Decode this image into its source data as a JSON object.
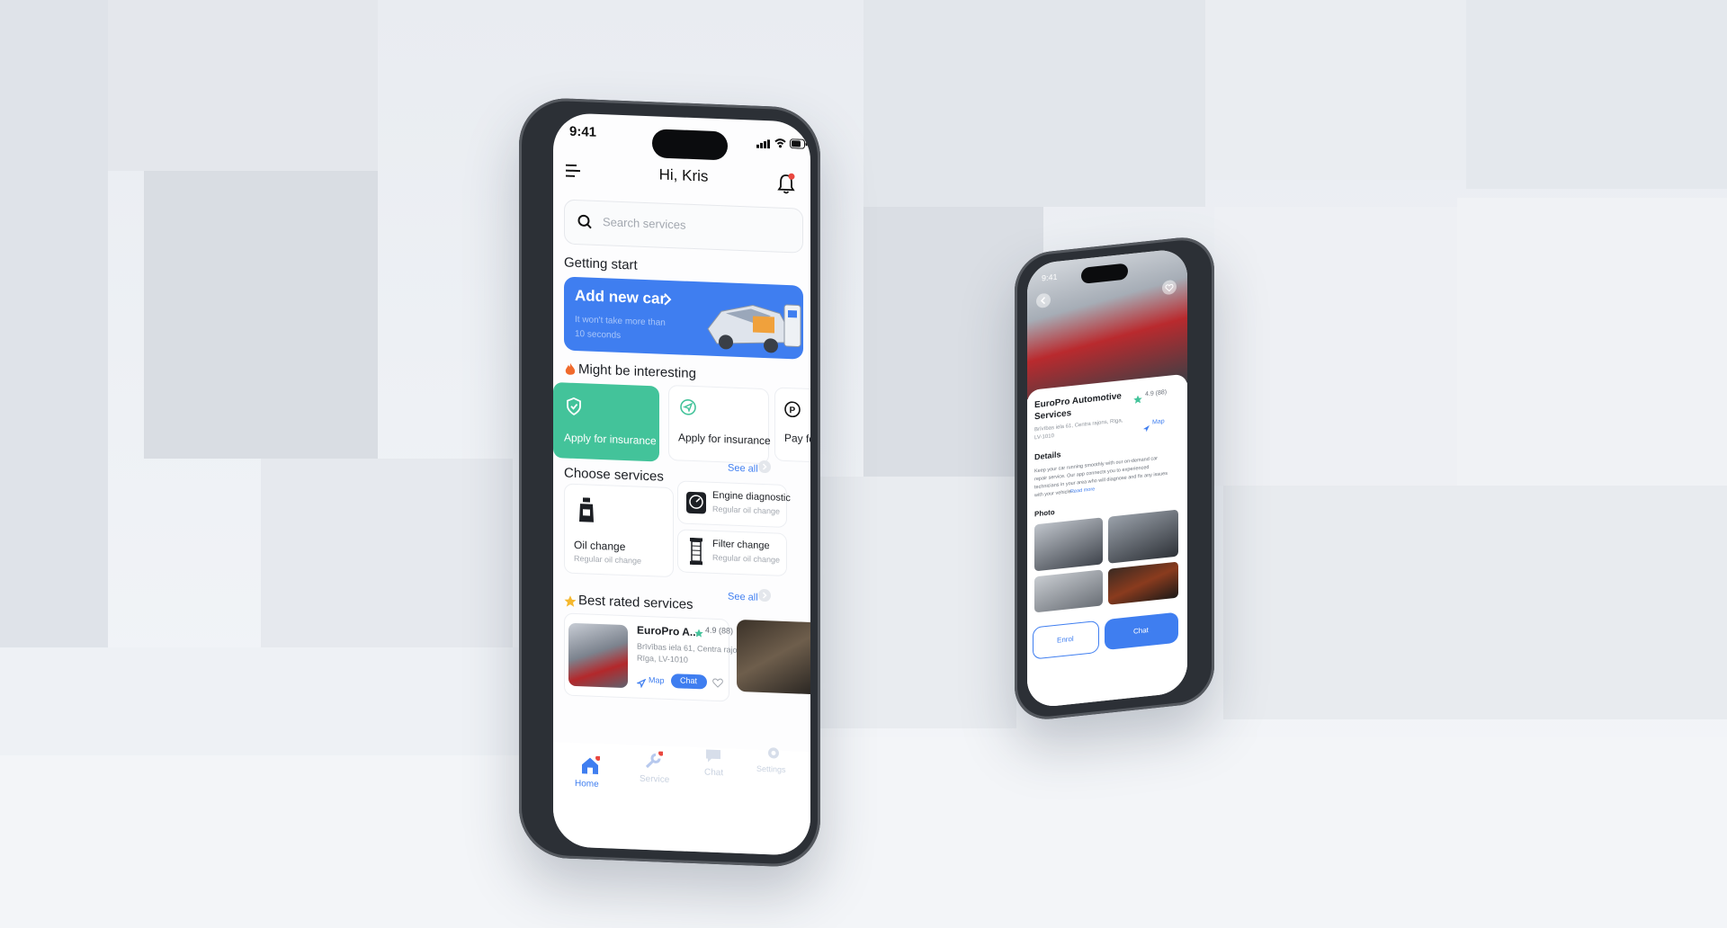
{
  "main_phone": {
    "status_time": "9:41",
    "greeting": "Hi, Kris",
    "search_placeholder": "Search services",
    "getting_start": "Getting start",
    "add_car": {
      "title": "Add new car",
      "subtitle_1": "It won't take more than",
      "subtitle_2": "10 seconds"
    },
    "interesting": {
      "title": "Might be interesting",
      "cards": [
        "Apply for insurance",
        "Apply for insurance",
        "Pay fo"
      ]
    },
    "choose_services": {
      "title": "Choose services",
      "see_all": "See all",
      "items": [
        {
          "name": "Oil change",
          "desc": "Regular oil change"
        },
        {
          "name": "Engine diagnostic",
          "desc": "Regular oil change"
        },
        {
          "name": "Filter change",
          "desc": "Regular oil change"
        }
      ]
    },
    "best_rated": {
      "title": "Best rated services",
      "see_all": "See all",
      "card": {
        "name": "EuroPro A...",
        "rating": "4.9 (88)",
        "addr_1": "Brīvības iela 61, Centra rajons,",
        "addr_2": "Rīga, LV-1010",
        "map": "Map",
        "chat": "Chat"
      }
    },
    "tabbar": [
      "Home",
      "Service",
      "Chat",
      "Settings"
    ]
  },
  "second_phone": {
    "status_time": "9:41",
    "title_1": "EuroPro Automotive",
    "title_2": "Services",
    "rating": "4.9 (88)",
    "addr_1": "Brīvības iela 61, Centra rajons, Rīga,",
    "addr_2": "LV-1010",
    "map": "Map",
    "details_title": "Details",
    "details_1": "Keep your car running smoothly with our on-demand car",
    "details_2": "repair service. Our app connects you to experienced",
    "details_3": "technicians in your area who will diagnose and fix any issues",
    "details_4": "with your vehicle...",
    "read_more": "Read more",
    "photo_title": "Photo",
    "enrol": "Enrol",
    "chat": "Chat"
  },
  "colors": {
    "blue": "#3f7ef0",
    "green": "#43c39a",
    "text": "#1c1f24",
    "muted": "#a3a8b0",
    "red": "#e9473f"
  }
}
